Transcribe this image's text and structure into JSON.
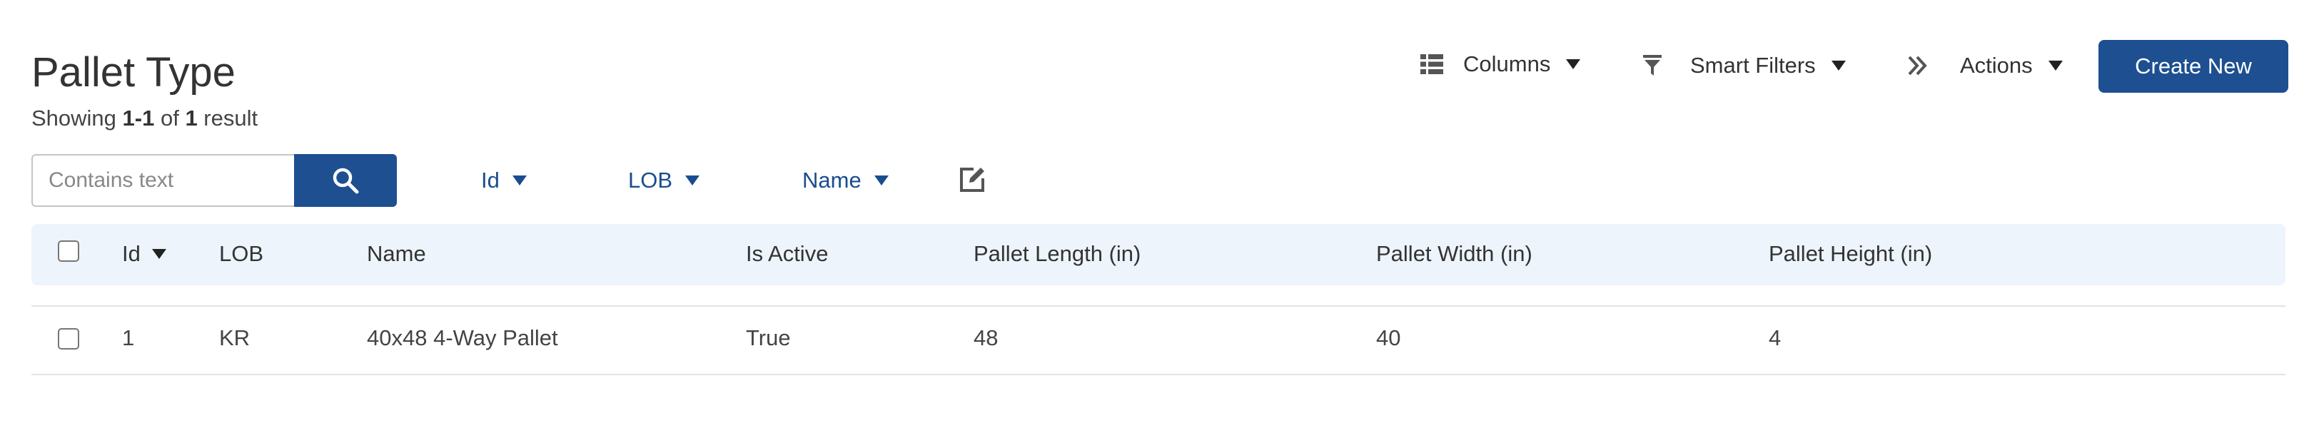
{
  "page": {
    "title": "Pallet Type",
    "subtitle": {
      "prefix": "Showing ",
      "range": "1-1",
      "of": " of ",
      "count": "1",
      "suffix": " result"
    }
  },
  "toolbar": {
    "columns_label": "Columns",
    "smart_filters_label": "Smart Filters",
    "actions_label": "Actions",
    "create_label": "Create New"
  },
  "search": {
    "placeholder": "Contains text",
    "value": ""
  },
  "filters": [
    {
      "label": "Id"
    },
    {
      "label": "LOB"
    },
    {
      "label": "Name"
    }
  ],
  "table": {
    "columns": [
      "Id",
      "LOB",
      "Name",
      "Is Active",
      "Pallet Length (in)",
      "Pallet Width (in)",
      "Pallet Height (in)"
    ],
    "sort_column": "Id",
    "rows": [
      {
        "id": "1",
        "lob": "KR",
        "name": "40x48 4-Way Pallet",
        "is_active": "True",
        "length": "48",
        "width": "40",
        "height": "4"
      }
    ]
  },
  "colors": {
    "primary": "#1d4f91",
    "link": "#1a4d8f",
    "header_bg": "#edf4fc"
  },
  "icons": [
    "list-icon",
    "filter-icon",
    "double-chevron-right-icon",
    "search-icon",
    "edit-icon",
    "caret-down-icon"
  ]
}
